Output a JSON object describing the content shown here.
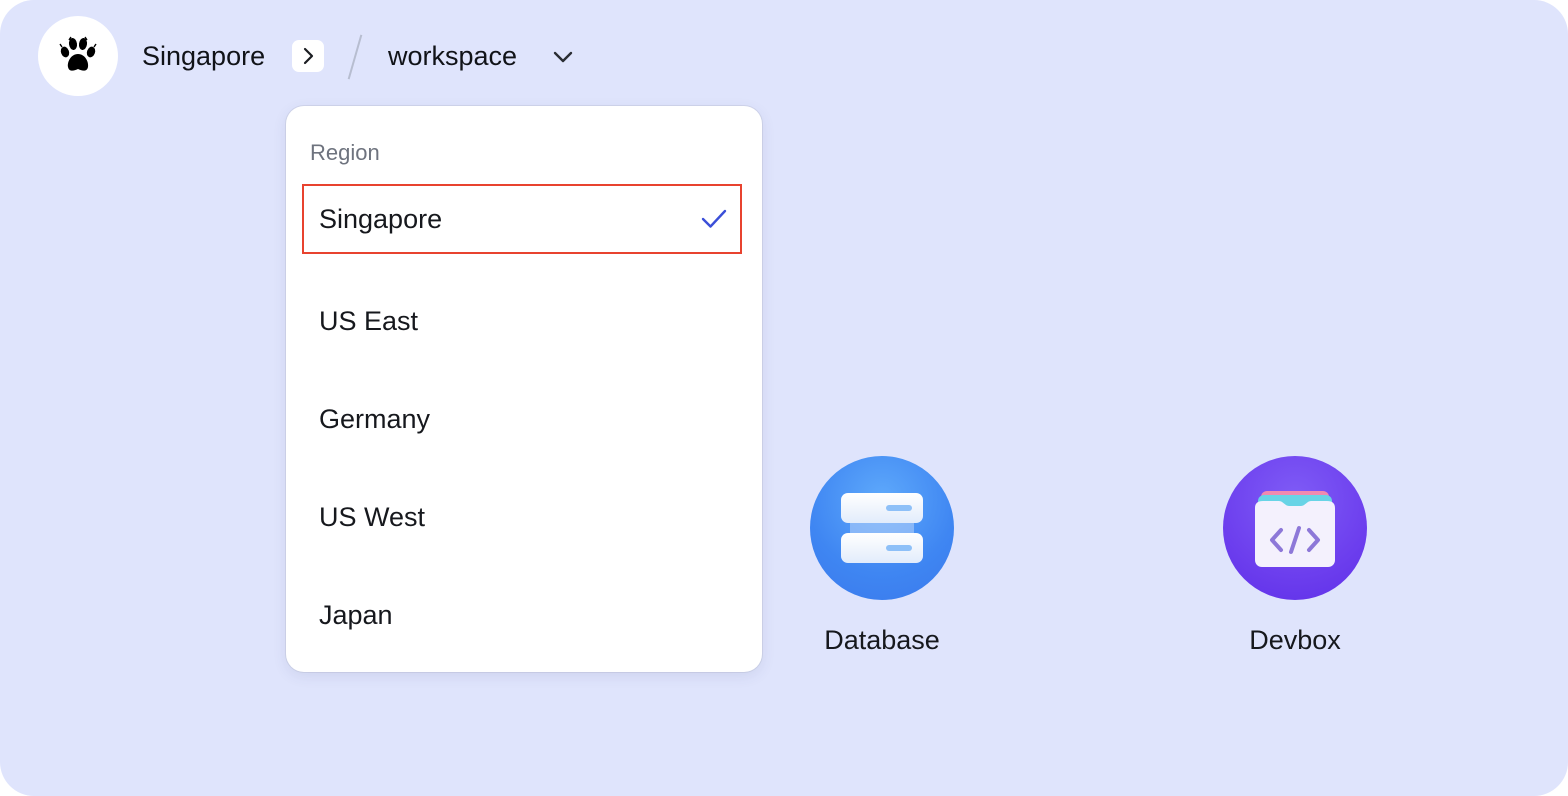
{
  "header": {
    "logo_icon": "paw-icon",
    "region_label": "Singapore",
    "region_chevron_icon": "chevron-right-icon",
    "workspace_label": "workspace",
    "workspace_chevron_icon": "chevron-down-icon"
  },
  "dropdown": {
    "heading": "Region",
    "items": [
      {
        "label": "Singapore",
        "selected": true
      },
      {
        "label": "US East",
        "selected": false
      },
      {
        "label": "Germany",
        "selected": false
      },
      {
        "label": "US West",
        "selected": false
      },
      {
        "label": "Japan",
        "selected": false
      }
    ],
    "check_icon": "checkmark-icon",
    "check_color": "#3b4fd8",
    "highlight_color": "#e8432f"
  },
  "apps": [
    {
      "label": "Database",
      "icon": "database-icon",
      "color": "#4a90f5"
    },
    {
      "label": "Devbox",
      "icon": "devbox-code-icon",
      "color": "#6a3ff0"
    }
  ],
  "colors": {
    "background": "#dfe4fc",
    "surface": "#ffffff"
  }
}
